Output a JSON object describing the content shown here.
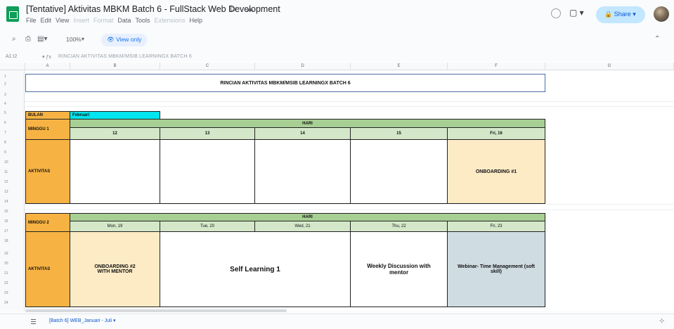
{
  "app": {
    "doc_title": "[Tentative] Aktivitas MBKM Batch 6 - FullStack Web Development",
    "title_icons": "☆ ⧉ ☁",
    "menu": [
      {
        "label": "File",
        "dim": false
      },
      {
        "label": "Edit",
        "dim": false
      },
      {
        "label": "View",
        "dim": false
      },
      {
        "label": "Insert",
        "dim": true
      },
      {
        "label": "Format",
        "dim": true
      },
      {
        "label": "Data",
        "dim": false
      },
      {
        "label": "Tools",
        "dim": false
      },
      {
        "label": "Extensions",
        "dim": true
      },
      {
        "label": "Help",
        "dim": false
      }
    ],
    "share_label": "Share",
    "meet_label": "▢ ▾"
  },
  "toolbar": {
    "search_icon": "⌕",
    "print_icon": "⎙",
    "paint_icon": "▤▾",
    "zoom": "100%",
    "zoom_caret": "▾",
    "view_only": "View only",
    "collapse": "⌃"
  },
  "formula_bar": {
    "cell_ref": "A1:I2",
    "fx": "▾  ƒx",
    "value": "RINCIAN AKTIVITAS MBKM/MSIB LEARNINGX BATCH 6"
  },
  "column_headers": [
    "A",
    "B",
    "C",
    "D",
    "E",
    "F",
    "G"
  ],
  "row_numbers": [
    "1",
    "2",
    "3",
    "4",
    "5",
    "6",
    "7",
    "8",
    "9",
    "10",
    "11",
    "12",
    "13",
    "14",
    "15",
    "16",
    "17",
    "18",
    "19",
    "20",
    "21",
    "22",
    "23",
    "24"
  ],
  "sheet": {
    "title": "RINCIAN AKTIVITAS MBKM/MSIB LEARNINGX BATCH 6",
    "bulan_label": "BULAN",
    "bulan_value": "Februari",
    "week1": {
      "label": "MINGGU 1",
      "hari": "HARI",
      "days": [
        "12",
        "13",
        "14",
        "15",
        "Fri, 16"
      ],
      "aktivitas_label": "AKTIVITAS",
      "activities": [
        "",
        "",
        "",
        "",
        "ONBOARDING #1"
      ]
    },
    "week2": {
      "label": "MINGGU 2",
      "hari": "HARI",
      "days": [
        "Mon, 19",
        "Tue, 20",
        "Wed, 21",
        "Thu, 22",
        "Fri, 23"
      ],
      "aktivitas_label": "AKTIVITAS",
      "activity_onboarding": "ONBOARDING #2 WITH MENTOR",
      "activity_self": "Self Learning 1",
      "activity_weekly": "Weekly Discussion with mentor",
      "activity_webinar": "Webinar- Time Management (soft skill)"
    }
  },
  "bottom": {
    "sheet_tab": "[Batch 6] WEB_Januari - Juli",
    "tab_caret": "▾",
    "explore": "⊹"
  },
  "colors": {
    "orange": "#f6b343",
    "cyan": "#00e5ef",
    "green": "#a8cf93",
    "light_green": "#d4e8c9",
    "cream": "#fdebc6",
    "slate": "#cfdce2",
    "share": "#c2e7ff"
  }
}
